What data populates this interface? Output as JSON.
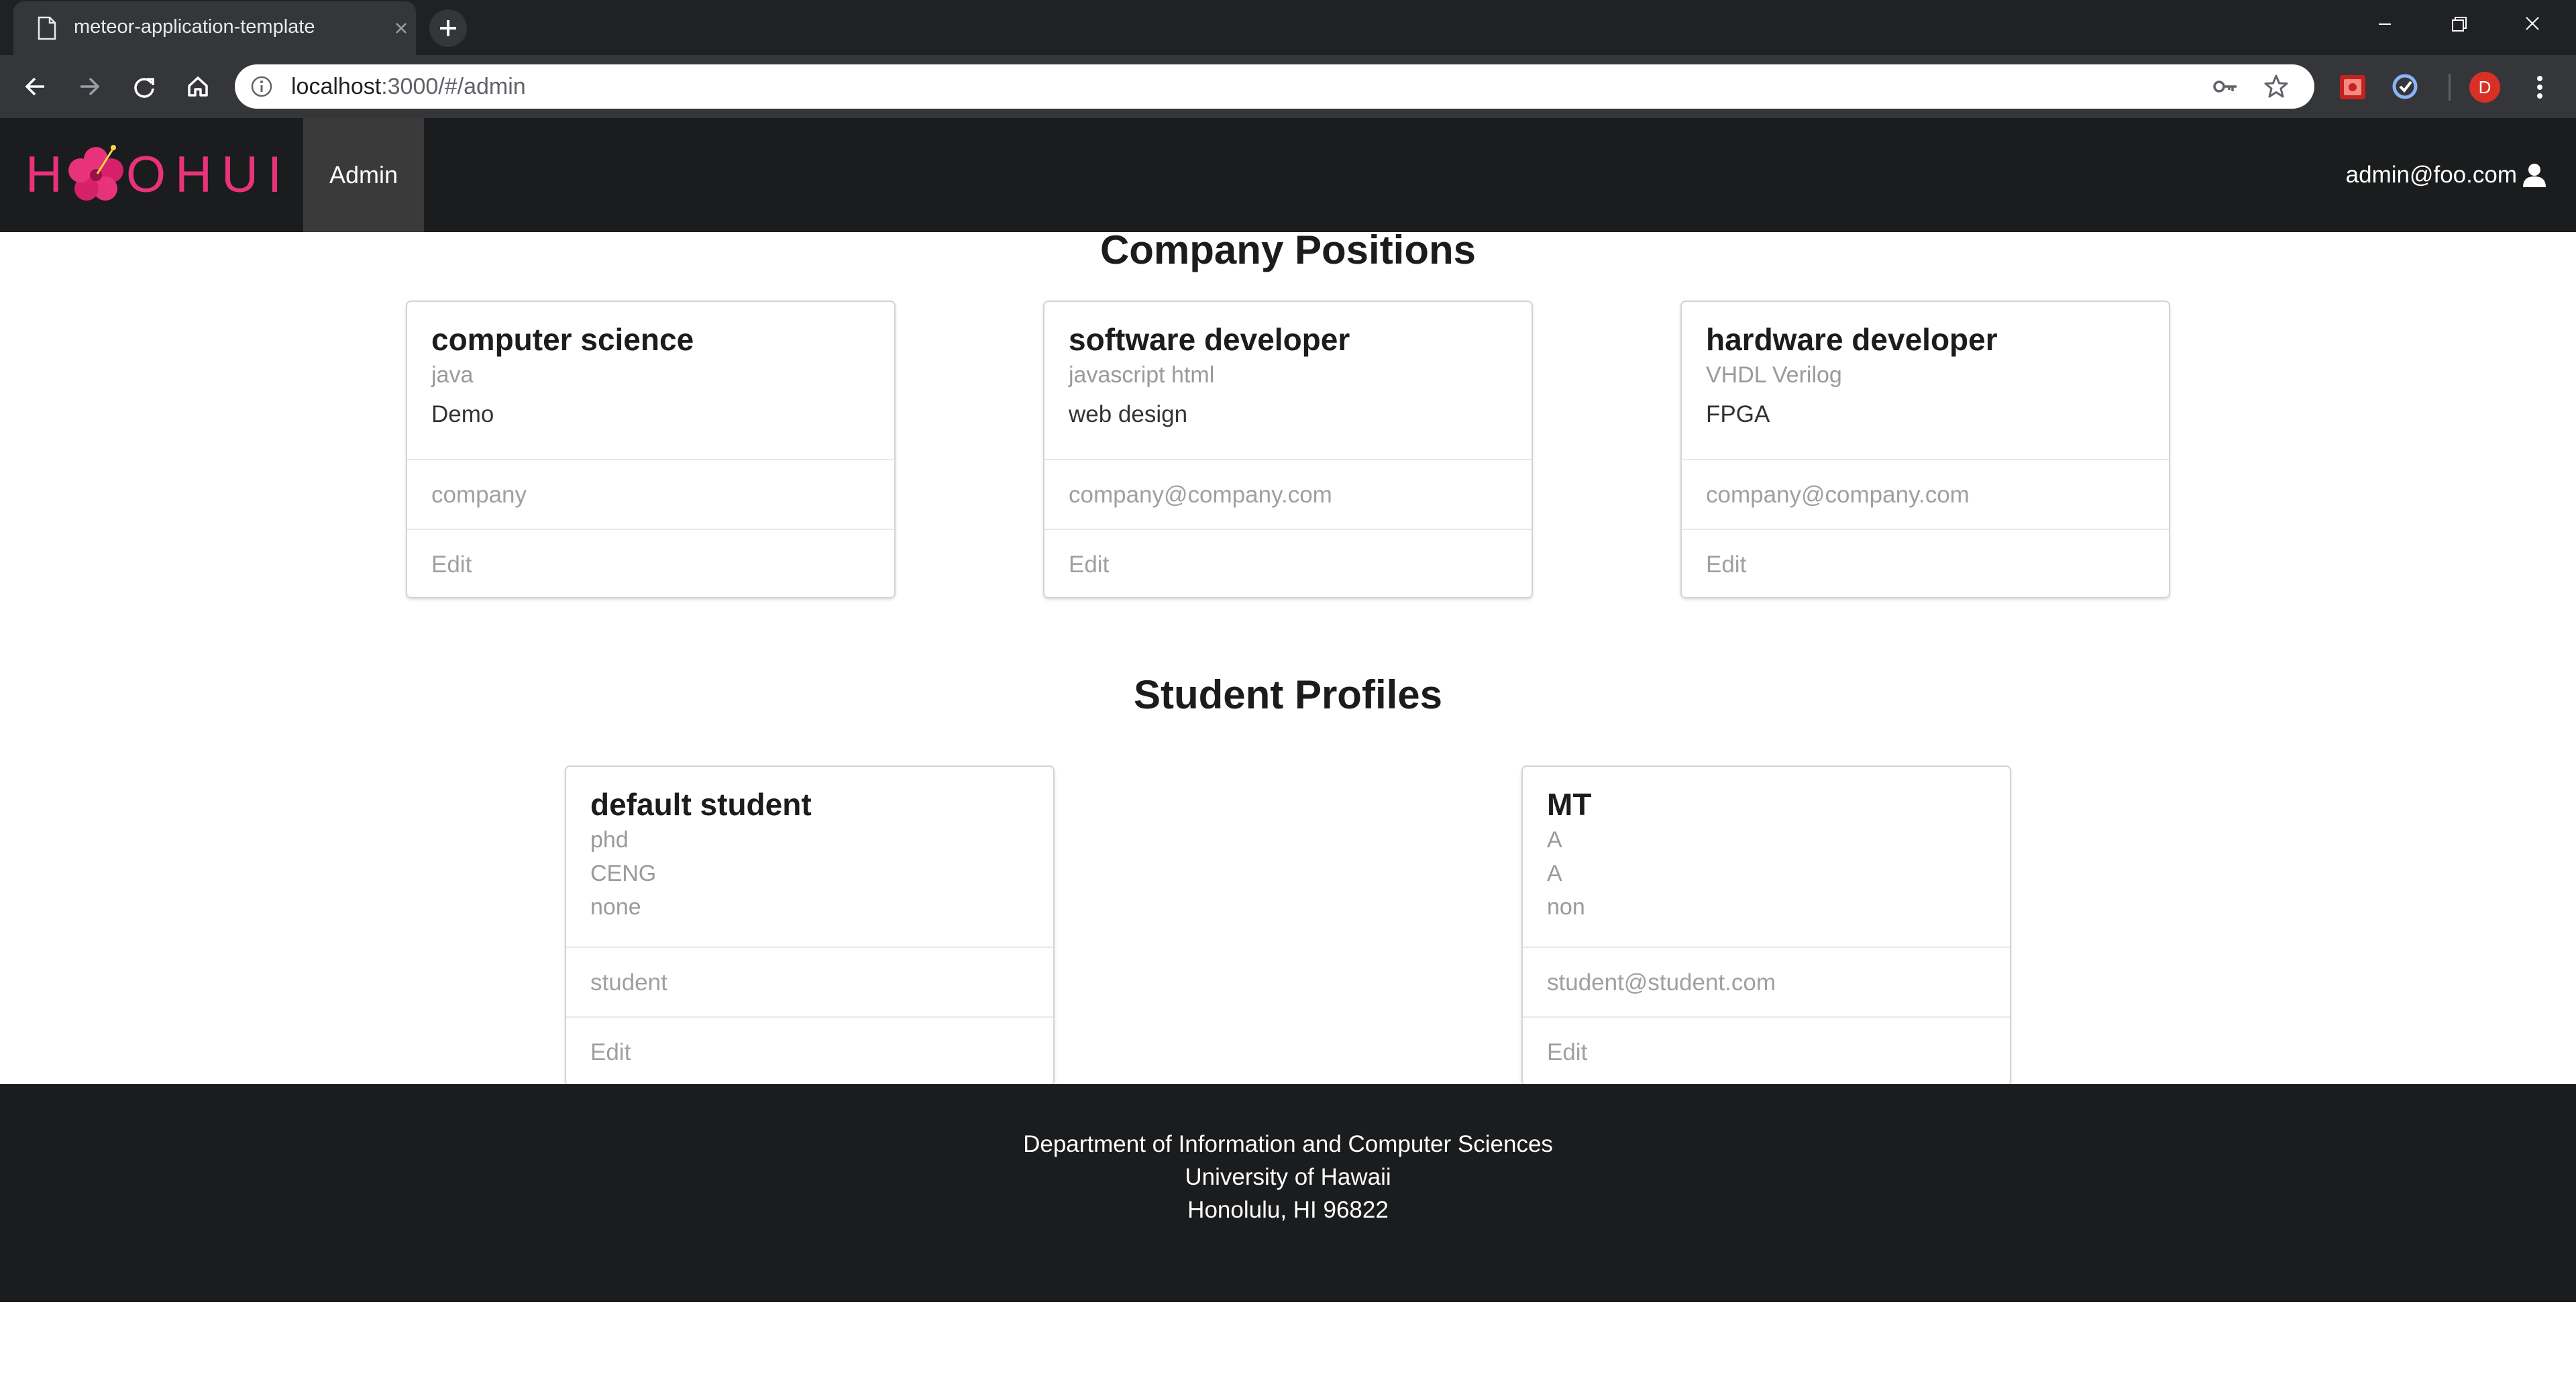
{
  "browser": {
    "tab_title": "meteor-application-template",
    "url_host": "localhost",
    "url_rest": ":3000/#/admin",
    "profile_initial": "D"
  },
  "navbar": {
    "brand": "HOHUI",
    "active_item": "Admin",
    "user_email": "admin@foo.com"
  },
  "sections": {
    "positions_title": "Company Positions",
    "profiles_title": "Student Profiles"
  },
  "positions": [
    {
      "title": "computer science",
      "skills": "java",
      "description": "Demo",
      "company": "company",
      "edit": "Edit"
    },
    {
      "title": "software developer",
      "skills": "javascript html",
      "description": "web design",
      "company": "company@company.com",
      "edit": "Edit"
    },
    {
      "title": "hardware developer",
      "skills": "VHDL Verilog",
      "description": "FPGA",
      "company": "company@company.com",
      "edit": "Edit"
    }
  ],
  "students": [
    {
      "name": "default student",
      "line1": "phd",
      "line2": "CENG",
      "line3": "none",
      "owner": "student",
      "edit": "Edit"
    },
    {
      "name": "MT",
      "line1": "A",
      "line2": "A",
      "line3": "non",
      "owner": "student@student.com",
      "edit": "Edit"
    }
  ],
  "footer": {
    "line1": "Department of Information and Computer Sciences",
    "line2": "University of Hawaii",
    "line3": "Honolulu, HI 96822"
  },
  "colors": {
    "navbar_bg": "#1b1c1d",
    "active_nav_bg": "#3a3a3b",
    "logo_pink": "#e8337a",
    "profile_avatar": "#d93025"
  }
}
